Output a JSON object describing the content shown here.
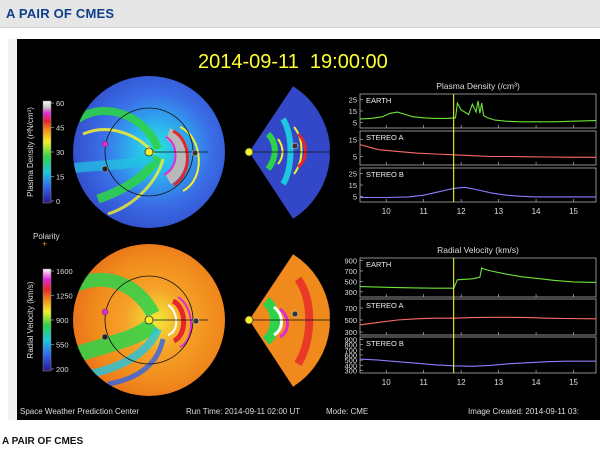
{
  "header": {
    "title": "A PAIR OF CMES"
  },
  "caption": "A PAIR OF CMES",
  "figure": {
    "timestamp": "2014-09-11  19:00:00",
    "footer_left": "Space Weather Prediction Center",
    "footer_runtime": "Run Time: 2014-09-11 02:00 UT",
    "footer_mode": "Mode: CME",
    "footer_created": "Image Created: 2014-09-11 03:",
    "polarity_label": "Polarity",
    "polarity_symbol": "+",
    "colorbar_density": {
      "label": "Plasma Density (r²N/cm³)",
      "ticks": [
        "60",
        "45",
        "30",
        "15",
        "0"
      ]
    },
    "colorbar_velocity": {
      "label": "Radial Velocity (km/s)",
      "ticks": [
        "1600",
        "1250",
        "900",
        "550",
        "200"
      ]
    }
  },
  "chart_data": [
    {
      "type": "line",
      "title": "Plasma Density (/cm³)",
      "x_ticks": [
        10,
        11,
        12,
        13,
        14,
        15
      ],
      "xlim": [
        9.3,
        15.6
      ],
      "current_time": 11.8,
      "panels": [
        {
          "name": "EARTH",
          "color": "#6fe33a",
          "ylim": [
            0,
            30
          ],
          "yticks": [
            5,
            15,
            25
          ],
          "x": [
            9.3,
            9.6,
            9.9,
            10.1,
            10.3,
            10.5,
            10.7,
            11.0,
            11.3,
            11.6,
            11.85,
            11.9,
            12.0,
            12.1,
            12.2,
            12.3,
            12.4,
            12.45,
            12.5,
            12.55,
            12.6,
            12.7,
            12.9,
            13.2,
            13.6,
            14.0,
            14.5,
            15.0,
            15.6
          ],
          "y": [
            8,
            8.5,
            10,
            13,
            14,
            12,
            10,
            9,
            8.5,
            8.5,
            9,
            22,
            16,
            14,
            12,
            21,
            14,
            24,
            13,
            22,
            11,
            9,
            7,
            6,
            5.5,
            5.5,
            5.5,
            6,
            6.5
          ]
        },
        {
          "name": "STEREO A",
          "color": "#ff6b6b",
          "ylim": [
            0,
            20
          ],
          "yticks": [
            5,
            15
          ],
          "x": [
            9.3,
            9.8,
            10.3,
            10.8,
            11.3,
            11.8,
            12.3,
            12.8,
            13.3,
            13.8,
            14.3,
            14.8,
            15.6
          ],
          "y": [
            12,
            9,
            8,
            7,
            6.5,
            6,
            5.5,
            5,
            5,
            4.8,
            4.7,
            4.6,
            4.5
          ]
        },
        {
          "name": "STEREO B",
          "color": "#8a7dff",
          "ylim": [
            0,
            30
          ],
          "yticks": [
            5,
            15,
            25
          ],
          "x": [
            9.3,
            10.0,
            10.6,
            11.0,
            11.4,
            11.8,
            12.1,
            12.4,
            12.8,
            13.2,
            13.6,
            14.0,
            14.5,
            15.0,
            15.6
          ],
          "y": [
            4,
            4,
            4.5,
            6,
            9,
            12,
            13,
            11,
            8,
            6,
            5,
            4.5,
            4.5,
            4.5,
            4.5
          ]
        }
      ]
    },
    {
      "type": "line",
      "title": "Radial Velocity (km/s)",
      "x_ticks": [
        10,
        11,
        12,
        13,
        14,
        15
      ],
      "xlim": [
        9.3,
        15.6
      ],
      "current_time": 11.8,
      "panels": [
        {
          "name": "EARTH",
          "color": "#6fe33a",
          "ylim": [
            200,
            950
          ],
          "yticks": [
            300,
            500,
            700,
            900
          ],
          "x": [
            9.3,
            9.8,
            10.3,
            10.8,
            11.3,
            11.8,
            11.9,
            12.1,
            12.3,
            12.5,
            12.55,
            12.6,
            12.8,
            13.2,
            13.6,
            14.0,
            14.5,
            15.0,
            15.6
          ],
          "y": [
            400,
            390,
            380,
            375,
            370,
            370,
            530,
            540,
            550,
            580,
            760,
            740,
            700,
            640,
            590,
            560,
            520,
            490,
            480
          ]
        },
        {
          "name": "STEREO A",
          "color": "#ff6b6b",
          "ylim": [
            250,
            850
          ],
          "yticks": [
            300,
            500,
            700
          ],
          "x": [
            9.3,
            9.8,
            10.3,
            10.8,
            11.3,
            11.8,
            12.3,
            12.8,
            13.3,
            13.8,
            14.3,
            14.8,
            15.6
          ],
          "y": [
            420,
            460,
            500,
            520,
            530,
            530,
            540,
            545,
            545,
            540,
            530,
            525,
            520
          ]
        },
        {
          "name": "STEREO B",
          "color": "#8a7dff",
          "ylim": [
            250,
            950
          ],
          "yticks": [
            300,
            400,
            500,
            600,
            700,
            800,
            900
          ],
          "x": [
            9.3,
            9.8,
            10.3,
            10.8,
            11.3,
            11.8,
            12.3,
            12.8,
            13.3,
            13.8,
            14.3,
            14.8,
            15.6
          ],
          "y": [
            520,
            500,
            470,
            440,
            410,
            390,
            380,
            400,
            430,
            450,
            470,
            480,
            480
          ]
        }
      ]
    }
  ]
}
